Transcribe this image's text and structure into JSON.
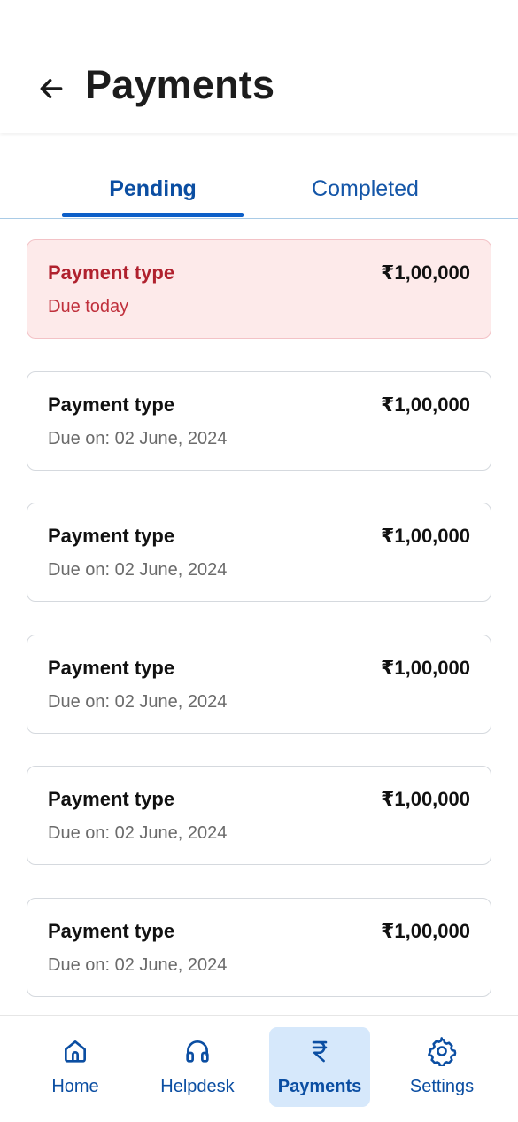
{
  "header": {
    "title": "Payments"
  },
  "tabs": [
    {
      "label": "Pending",
      "active": true
    },
    {
      "label": "Completed",
      "active": false
    }
  ],
  "payments": [
    {
      "type": "Payment type",
      "amount": "₹1,00,000",
      "due": "Due today",
      "highlight": true
    },
    {
      "type": "Payment type",
      "amount": "₹1,00,000",
      "due": "Due on: 02 June, 2024",
      "highlight": false
    },
    {
      "type": "Payment type",
      "amount": "₹1,00,000",
      "due": "Due on: 02 June, 2024",
      "highlight": false
    },
    {
      "type": "Payment type",
      "amount": "₹1,00,000",
      "due": "Due on: 02 June, 2024",
      "highlight": false
    },
    {
      "type": "Payment type",
      "amount": "₹1,00,000",
      "due": "Due on: 02 June, 2024",
      "highlight": false
    },
    {
      "type": "Payment type",
      "amount": "₹1,00,000",
      "due": "Due on: 02 June, 2024",
      "highlight": false
    }
  ],
  "bottom_nav": [
    {
      "label": "Home",
      "icon": "home-icon",
      "active": false
    },
    {
      "label": "Helpdesk",
      "icon": "headphones-icon",
      "active": false
    },
    {
      "label": "Payments",
      "icon": "rupee-icon",
      "active": true
    },
    {
      "label": "Settings",
      "icon": "gear-icon",
      "active": false
    }
  ],
  "colors": {
    "primary": "#0b4ea2",
    "tab_indicator": "#0d5fc8",
    "due_background": "#fdeaea",
    "due_text": "#b0212e",
    "active_nav_background": "#d6e8fb"
  }
}
